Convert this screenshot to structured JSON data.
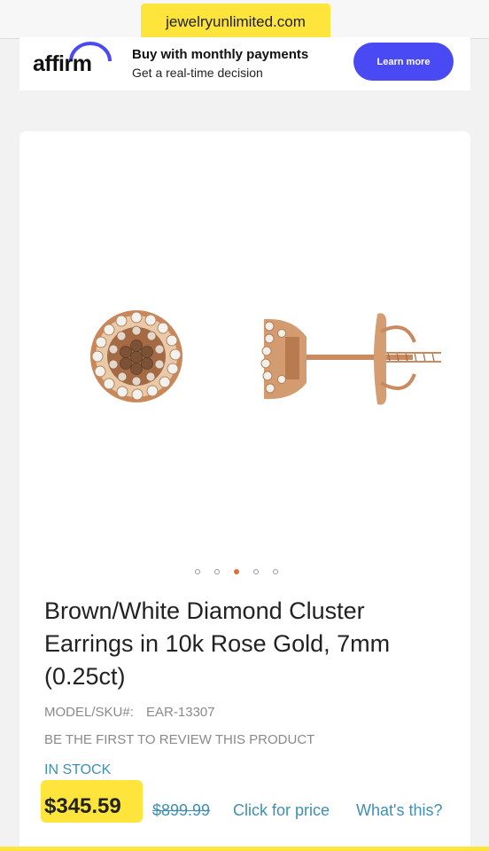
{
  "browser": {
    "url": "jewelryunlimited.com"
  },
  "affirm": {
    "logo": "affirm",
    "headline": "Buy with monthly payments",
    "subline": "Get a real-time decision",
    "cta": "Learn more"
  },
  "product": {
    "image_alt": "Brown/White diamond cluster stud earring, front and side view",
    "carousel": {
      "count": 5,
      "active_index": 2
    },
    "title": "Brown/White Diamond Cluster Earrings in 10k Rose Gold, 7mm (0.25ct)",
    "model_label": "MODEL/SKU#:",
    "model_value": "EAR-13307",
    "review_prompt": "BE THE FIRST TO REVIEW THIS PRODUCT",
    "stock_status": "IN STOCK",
    "price": "$345.59",
    "original_price": "$899.99",
    "click_for_price": "Click for price",
    "whats_this": "What's this?"
  },
  "colors": {
    "highlight": "#ffe43b",
    "link": "#3f8fb4",
    "affirm_button": "#4a4af4",
    "carousel_active": "#d9703a"
  }
}
